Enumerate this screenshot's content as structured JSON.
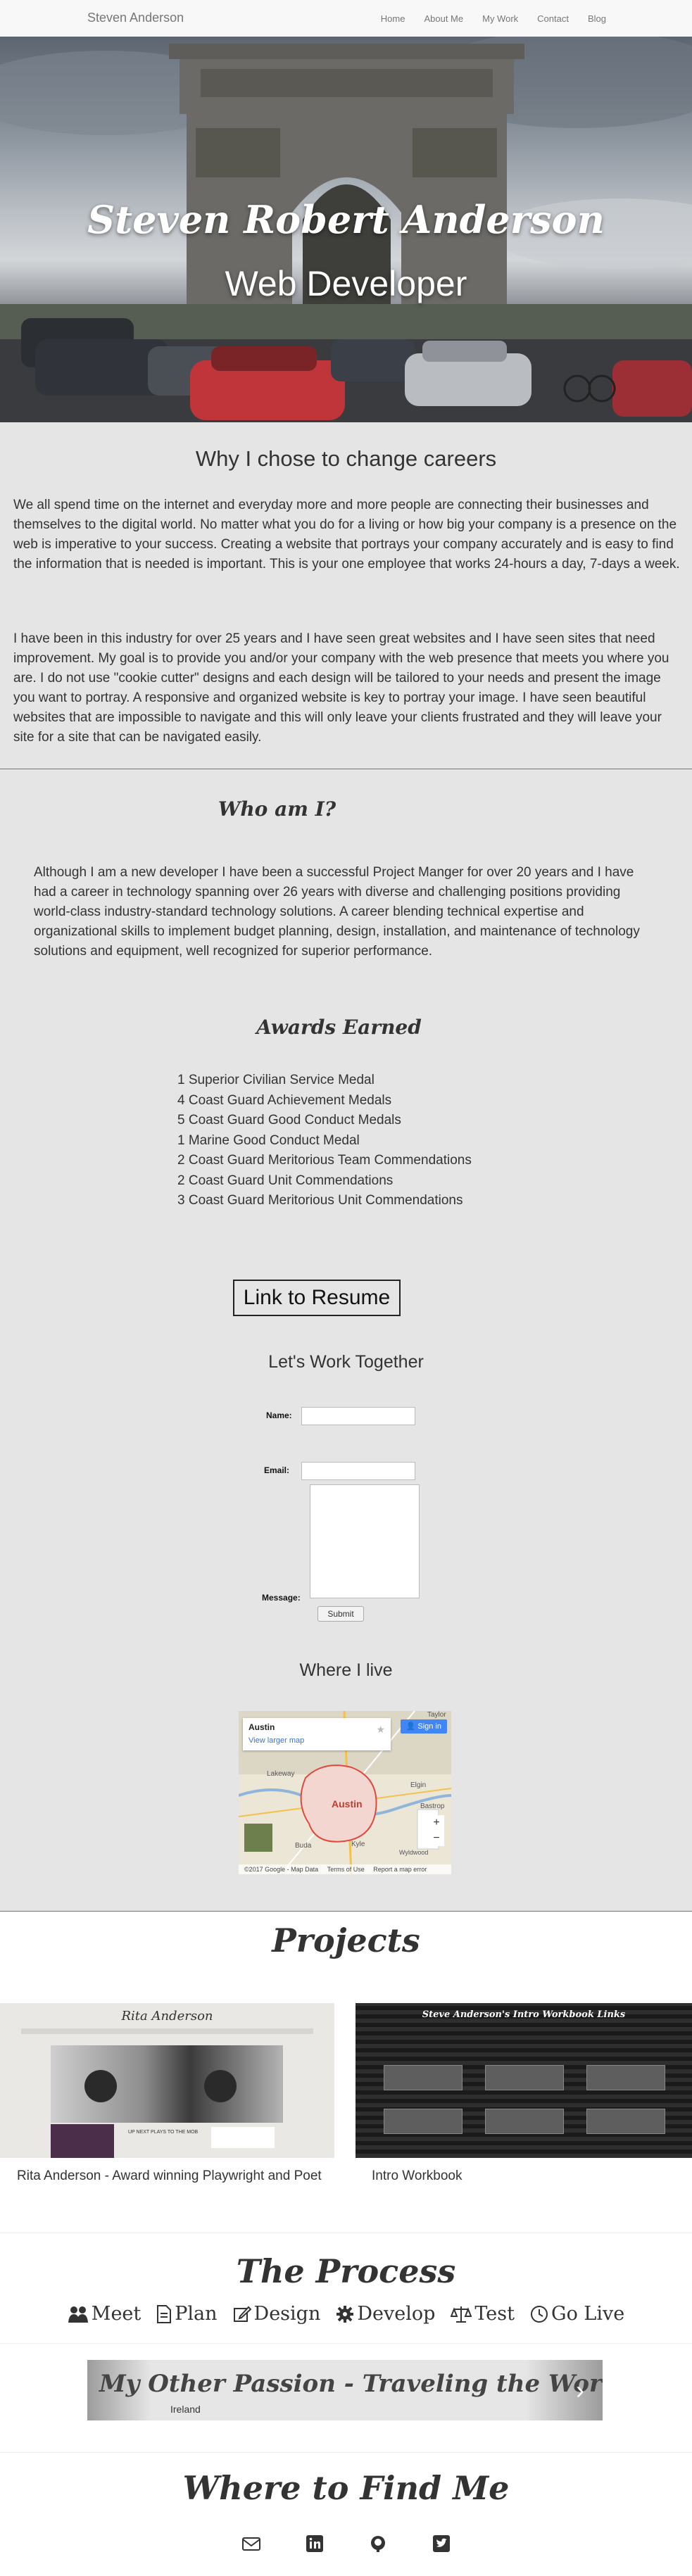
{
  "navbar": {
    "brand": "Steven Anderson",
    "links": [
      "Home",
      "About Me",
      "My Work",
      "Contact",
      "Blog"
    ]
  },
  "hero": {
    "name": "Steven Robert Anderson",
    "title": "Web Developer"
  },
  "why": {
    "heading": "Why I chose to change careers",
    "p1": "We all spend time on the internet and everyday more and more people are connecting their businesses and themselves to the digital world. No matter what you do for a living or how big your company is a presence on the web is imperative to your success. Creating a website that portrays your company accurately and is easy to find the information that is needed is important. This is your one employee that works 24-hours a day, 7-days a week.",
    "p2": "I have been in this industry for over 25 years and I have seen great websites and I have seen sites that need improvement. My goal is to provide you and/or your company with the web presence that meets you where you are. I do not use \"cookie cutter\" designs and each design will be tailored to your needs and present the image you want to portray. A responsive and organized website is key to portray your image. I have seen beautiful websites that are impossible to navigate and this will only leave your clients frustrated and they will leave your site for a site that can be navigated easily."
  },
  "who": {
    "heading": "Who am I?",
    "text": "Although I am a new developer I have been a successful Project Manger for over 20 years and I have had a career in technology spanning over 26 years with diverse and challenging positions providing world-class industry-standard technology solutions. A career blending technical expertise and organizational skills to implement budget planning, design, installation, and maintenance of technology solutions and equipment, well recognized for superior performance."
  },
  "awards": {
    "heading": "Awards Earned",
    "items": [
      "1 Superior Civilian Service Medal",
      "4 Coast Guard Achievement Medals",
      "5 Coast Guard Good Conduct Medals",
      "1 Marine Good Conduct Medal",
      "2 Coast Guard Meritorious Team Commendations",
      "2 Coast Guard Unit Commendations",
      "3 Coast Guard Meritorious Unit Commendations"
    ]
  },
  "resume": {
    "label": "Link to Resume"
  },
  "contact": {
    "heading": "Let's Work Together",
    "name_label": "Name:",
    "name_value": "",
    "email_label": "Email:",
    "email_value": "",
    "message_label": "Message:",
    "message_value": "",
    "submit_label": "Submit"
  },
  "location": {
    "heading": "Where I live",
    "map": {
      "place": "Austin",
      "view_larger": "View larger map",
      "sign_in": "Sign in",
      "city_label": "Austin",
      "places": [
        "Lakeway",
        "Taylor",
        "Elgin",
        "Bastrop",
        "Wyldwood",
        "Kyle",
        "Buda"
      ],
      "footer": [
        "©2017 Google - Map Data",
        "Terms of Use",
        "Report a map error"
      ],
      "zoom_in": "+",
      "zoom_out": "−"
    }
  },
  "projects": {
    "heading": "Projects",
    "items": [
      {
        "caption": "Rita Anderson - Award winning Playwright and Poet",
        "thumb_title": "Rita Anderson",
        "thumb_link": "UP NEXT PLAYS TO THE MOB"
      },
      {
        "caption": "Intro Workbook",
        "thumb_title": "Steve Anderson's Intro Workbook Links"
      }
    ]
  },
  "process": {
    "heading": "The Process",
    "steps": [
      {
        "icon": "people-icon",
        "label": "Meet"
      },
      {
        "icon": "document-icon",
        "label": "Plan"
      },
      {
        "icon": "edit-icon",
        "label": "Design"
      },
      {
        "icon": "gear-icon",
        "label": "Develop"
      },
      {
        "icon": "balance-icon",
        "label": "Test"
      },
      {
        "icon": "clock-icon",
        "label": "Go Live"
      }
    ]
  },
  "passion": {
    "title": "My Other Passion - Traveling the World",
    "caption": "Ireland"
  },
  "find": {
    "heading": "Where to Find Me",
    "links": [
      "envelope-icon",
      "linkedin-icon",
      "github-icon",
      "twitter-icon"
    ]
  },
  "colors": {
    "section_gray": "#e5e5e5",
    "navbar_bg": "#f8f8f8",
    "map_pin_red": "#e04a3d",
    "sign_in_blue": "#4285f4"
  }
}
